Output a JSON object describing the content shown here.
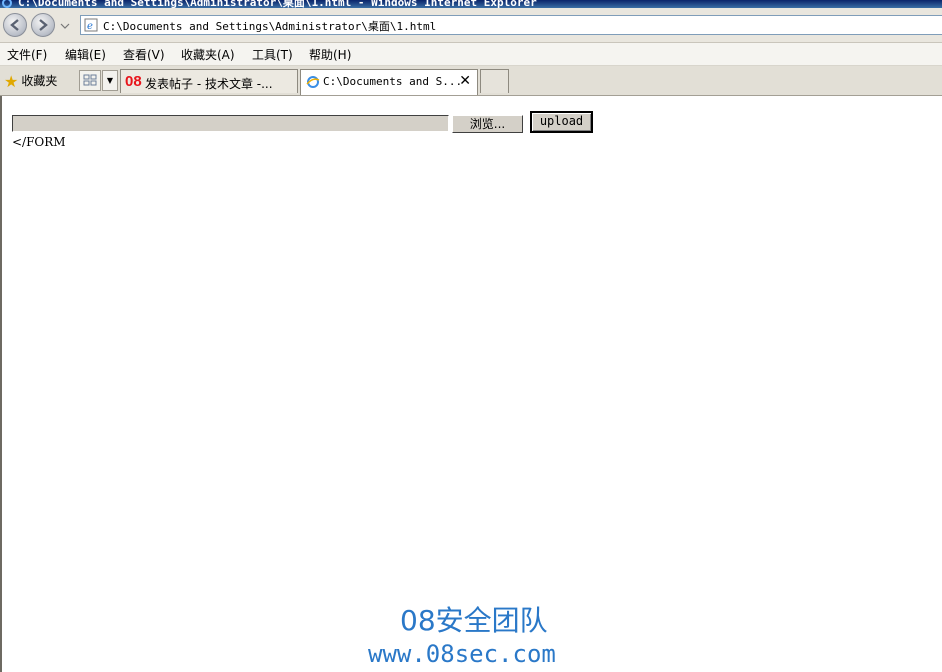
{
  "window": {
    "title": "C:\\Documents and Settings\\Administrator\\桌面\\1.html - Windows Internet Explorer"
  },
  "address_bar": {
    "url": "C:\\Documents and Settings\\Administrator\\桌面\\1.html"
  },
  "menu": {
    "items": [
      "文件(F)",
      "编辑(E)",
      "查看(V)",
      "收藏夹(A)",
      "工具(T)",
      "帮助(H)"
    ]
  },
  "favorites_bar": {
    "label": "收藏夹"
  },
  "tabs": [
    {
      "icon_text": "08",
      "label": "发表帖子 - 技术文章 -..."
    },
    {
      "label": "C:\\Documents and S...",
      "close": "✕"
    }
  ],
  "form": {
    "browse_label": "浏览...",
    "upload_label": "upload",
    "trailing_text": "</FORM"
  },
  "watermark": {
    "line1": "08安全团队",
    "line2": "www.08sec.com"
  },
  "colors": {
    "watermark": "#2a78c8",
    "tab_badge": "#e8141b"
  }
}
